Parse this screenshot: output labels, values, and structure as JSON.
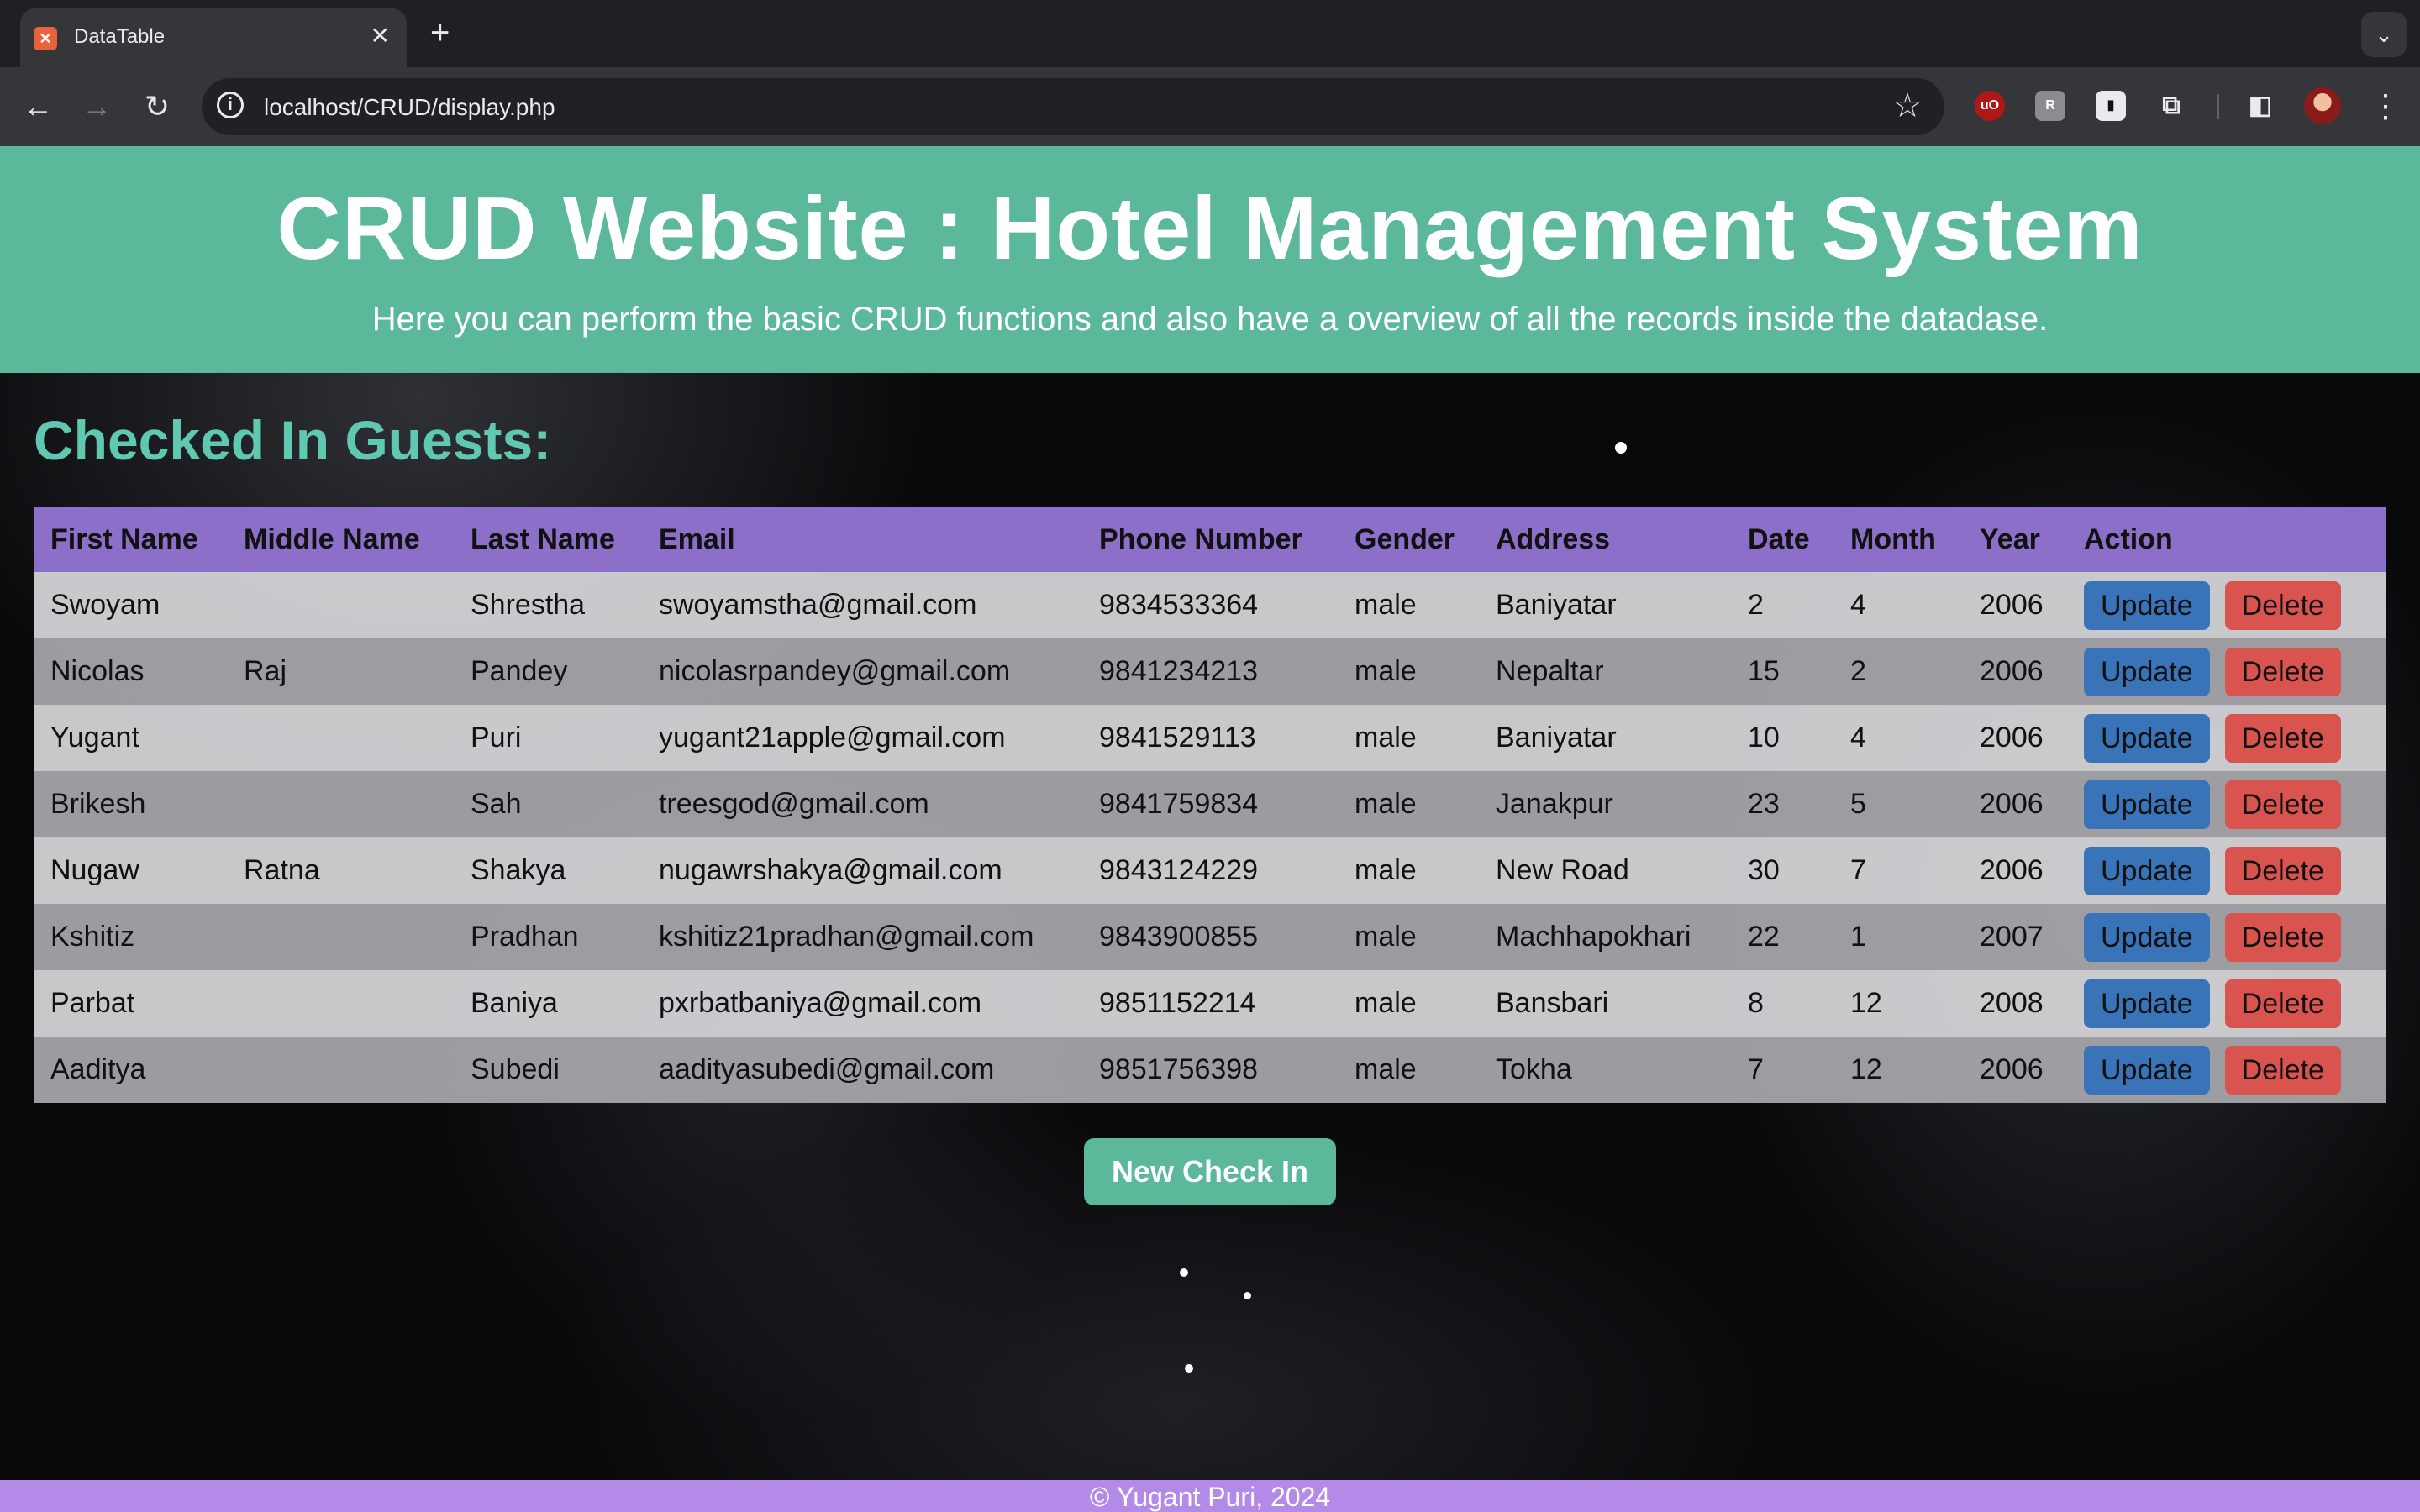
{
  "browser": {
    "tab_title": "DataTable",
    "tab_favicon": "xampp-icon",
    "url": "localhost/CRUD/display.php"
  },
  "header": {
    "title": "CRUD Website : Hotel Management System",
    "subtitle": "Here you can perform the basic CRUD functions and also have a overview of all the records inside the datadase."
  },
  "section_title": "Checked In Guests:",
  "table": {
    "columns": [
      "First Name",
      "Middle Name",
      "Last Name",
      "Email",
      "Phone Number",
      "Gender",
      "Address",
      "Date",
      "Month",
      "Year",
      "Action"
    ],
    "rows": [
      [
        "Swoyam",
        "",
        "Shrestha",
        "swoyamstha@gmail.com",
        "9834533364",
        "male",
        "Baniyatar",
        "2",
        "4",
        "2006"
      ],
      [
        "Nicolas",
        "Raj",
        "Pandey",
        "nicolasrpandey@gmail.com",
        "9841234213",
        "male",
        "Nepaltar",
        "15",
        "2",
        "2006"
      ],
      [
        "Yugant",
        "",
        "Puri",
        "yugant21apple@gmail.com",
        "9841529113",
        "male",
        "Baniyatar",
        "10",
        "4",
        "2006"
      ],
      [
        "Brikesh",
        "",
        "Sah",
        "treesgod@gmail.com",
        "9841759834",
        "male",
        "Janakpur",
        "23",
        "5",
        "2006"
      ],
      [
        "Nugaw",
        "Ratna",
        "Shakya",
        "nugawrshakya@gmail.com",
        "9843124229",
        "male",
        "New Road",
        "30",
        "7",
        "2006"
      ],
      [
        "Kshitiz",
        "",
        "Pradhan",
        "kshitiz21pradhan@gmail.com",
        "9843900855",
        "male",
        "Machhapokhari",
        "22",
        "1",
        "2007"
      ],
      [
        "Parbat",
        "",
        "Baniya",
        "pxrbatbaniya@gmail.com",
        "9851152214",
        "male",
        "Bansbari",
        "8",
        "12",
        "2008"
      ],
      [
        "Aaditya",
        "",
        "Subedi",
        "aadityasubedi@gmail.com",
        "9851756398",
        "male",
        "Tokha",
        "7",
        "12",
        "2006"
      ]
    ],
    "update_label": "Update",
    "delete_label": "Delete"
  },
  "new_checkin_label": "New Check In",
  "footer": "© Yugant Puri, 2024",
  "colors": {
    "header_bg": "#5bb89b",
    "table_header_bg": "#8b6fc8",
    "update_btn": "#3a74b8",
    "delete_btn": "#d9534f",
    "footer_bg": "#b38ae8"
  }
}
